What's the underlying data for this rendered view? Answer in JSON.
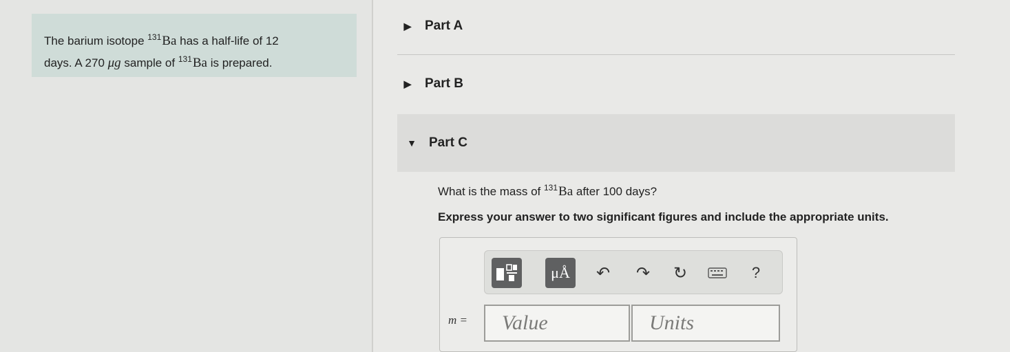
{
  "intro": {
    "line1_before": "The barium isotope ",
    "isotope_mass": "131",
    "element": "Ba",
    "line1_after": " has a half-life of 12",
    "line2_before": "days. A 270 ",
    "unit_mu_g": "μg",
    "line2_mid": " sample of ",
    "line2_after": " is prepared."
  },
  "parts": [
    {
      "label": "Part A",
      "expanded": false
    },
    {
      "label": "Part B",
      "expanded": false
    },
    {
      "label": "Part C",
      "expanded": true
    }
  ],
  "question": {
    "before": "What is the mass of ",
    "after": " after 100 days?",
    "instruction": "Express your answer to two significant figures and include the appropriate units."
  },
  "answer": {
    "variable_label": "m =",
    "value_placeholder": "Value",
    "units_placeholder": "Units"
  },
  "toolbar": {
    "units_button_label": "μÅ",
    "help_label": "?"
  }
}
